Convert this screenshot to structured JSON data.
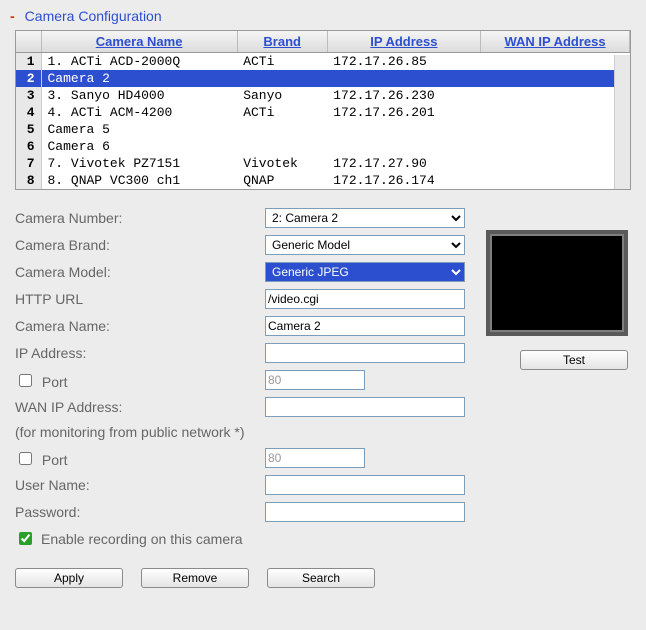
{
  "header": {
    "title": "Camera Configuration"
  },
  "table": {
    "columns": [
      "Camera Name",
      "Brand",
      "IP Address",
      "WAN IP Address"
    ],
    "rows": [
      {
        "idx": "1",
        "name": "1. ACTi ACD-2000Q",
        "brand": "ACTi",
        "ip": "172.17.26.85",
        "wan": ""
      },
      {
        "idx": "2",
        "name": "Camera 2",
        "brand": "",
        "ip": "",
        "wan": ""
      },
      {
        "idx": "3",
        "name": "3. Sanyo HD4000",
        "brand": "Sanyo",
        "ip": "172.17.26.230",
        "wan": ""
      },
      {
        "idx": "4",
        "name": "4. ACTi ACM-4200",
        "brand": "ACTi",
        "ip": "172.17.26.201",
        "wan": ""
      },
      {
        "idx": "5",
        "name": "Camera 5",
        "brand": "",
        "ip": "",
        "wan": ""
      },
      {
        "idx": "6",
        "name": "Camera 6",
        "brand": "",
        "ip": "",
        "wan": ""
      },
      {
        "idx": "7",
        "name": "7. Vivotek PZ7151",
        "brand": "Vivotek",
        "ip": "172.17.27.90",
        "wan": ""
      },
      {
        "idx": "8",
        "name": "8. QNAP VC300 ch1",
        "brand": "QNAP",
        "ip": "172.17.26.174",
        "wan": ""
      }
    ],
    "selected_index": 1
  },
  "form": {
    "labels": {
      "camera_number": "Camera Number:",
      "camera_brand": "Camera Brand:",
      "camera_model": "Camera Model:",
      "http_url": "HTTP URL",
      "camera_name": "Camera Name:",
      "ip_address": "IP Address:",
      "port1": "Port",
      "wan_ip": "WAN IP Address:",
      "note": "(for monitoring from public network *)",
      "port2": "Port",
      "user_name": "User Name:",
      "password": "Password:",
      "enable": "Enable recording on this camera"
    },
    "values": {
      "camera_number": "2: Camera 2",
      "camera_brand": "Generic Model",
      "camera_model": "Generic JPEG",
      "http_url": "/video.cgi",
      "camera_name": "Camera 2",
      "ip_address": "",
      "port1": "80",
      "wan_ip": "",
      "port2": "80",
      "user_name": "",
      "password": "",
      "enable_checked": true,
      "port1_checked": false,
      "port2_checked": false
    }
  },
  "buttons": {
    "test": "Test",
    "apply": "Apply",
    "remove": "Remove",
    "search": "Search"
  }
}
